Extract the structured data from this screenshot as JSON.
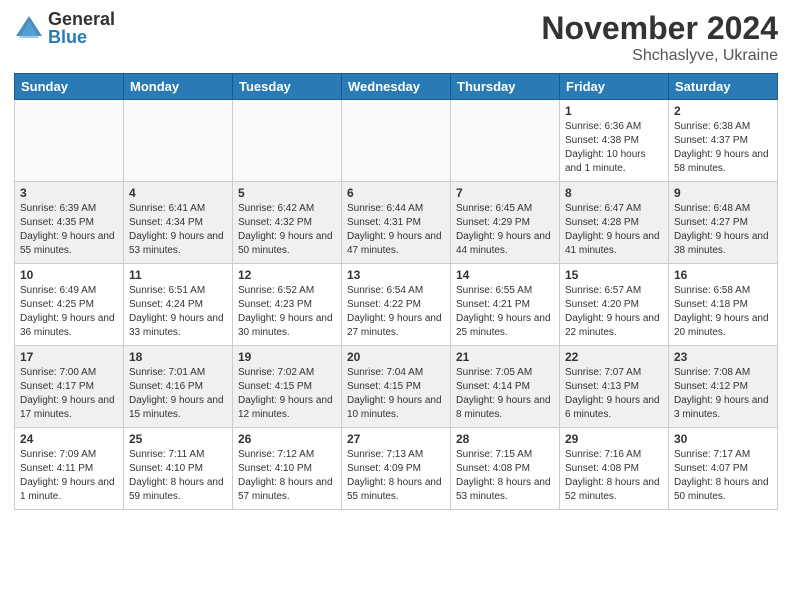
{
  "header": {
    "logo_general": "General",
    "logo_blue": "Blue",
    "month_title": "November 2024",
    "location": "Shchaslyve, Ukraine"
  },
  "weekdays": [
    "Sunday",
    "Monday",
    "Tuesday",
    "Wednesday",
    "Thursday",
    "Friday",
    "Saturday"
  ],
  "weeks": [
    [
      {
        "day": "",
        "empty": true
      },
      {
        "day": "",
        "empty": true
      },
      {
        "day": "",
        "empty": true
      },
      {
        "day": "",
        "empty": true
      },
      {
        "day": "",
        "empty": true
      },
      {
        "day": "1",
        "sunrise": "Sunrise: 6:36 AM",
        "sunset": "Sunset: 4:38 PM",
        "daylight": "Daylight: 10 hours and 1 minute."
      },
      {
        "day": "2",
        "sunrise": "Sunrise: 6:38 AM",
        "sunset": "Sunset: 4:37 PM",
        "daylight": "Daylight: 9 hours and 58 minutes."
      }
    ],
    [
      {
        "day": "3",
        "sunrise": "Sunrise: 6:39 AM",
        "sunset": "Sunset: 4:35 PM",
        "daylight": "Daylight: 9 hours and 55 minutes."
      },
      {
        "day": "4",
        "sunrise": "Sunrise: 6:41 AM",
        "sunset": "Sunset: 4:34 PM",
        "daylight": "Daylight: 9 hours and 53 minutes."
      },
      {
        "day": "5",
        "sunrise": "Sunrise: 6:42 AM",
        "sunset": "Sunset: 4:32 PM",
        "daylight": "Daylight: 9 hours and 50 minutes."
      },
      {
        "day": "6",
        "sunrise": "Sunrise: 6:44 AM",
        "sunset": "Sunset: 4:31 PM",
        "daylight": "Daylight: 9 hours and 47 minutes."
      },
      {
        "day": "7",
        "sunrise": "Sunrise: 6:45 AM",
        "sunset": "Sunset: 4:29 PM",
        "daylight": "Daylight: 9 hours and 44 minutes."
      },
      {
        "day": "8",
        "sunrise": "Sunrise: 6:47 AM",
        "sunset": "Sunset: 4:28 PM",
        "daylight": "Daylight: 9 hours and 41 minutes."
      },
      {
        "day": "9",
        "sunrise": "Sunrise: 6:48 AM",
        "sunset": "Sunset: 4:27 PM",
        "daylight": "Daylight: 9 hours and 38 minutes."
      }
    ],
    [
      {
        "day": "10",
        "sunrise": "Sunrise: 6:49 AM",
        "sunset": "Sunset: 4:25 PM",
        "daylight": "Daylight: 9 hours and 36 minutes."
      },
      {
        "day": "11",
        "sunrise": "Sunrise: 6:51 AM",
        "sunset": "Sunset: 4:24 PM",
        "daylight": "Daylight: 9 hours and 33 minutes."
      },
      {
        "day": "12",
        "sunrise": "Sunrise: 6:52 AM",
        "sunset": "Sunset: 4:23 PM",
        "daylight": "Daylight: 9 hours and 30 minutes."
      },
      {
        "day": "13",
        "sunrise": "Sunrise: 6:54 AM",
        "sunset": "Sunset: 4:22 PM",
        "daylight": "Daylight: 9 hours and 27 minutes."
      },
      {
        "day": "14",
        "sunrise": "Sunrise: 6:55 AM",
        "sunset": "Sunset: 4:21 PM",
        "daylight": "Daylight: 9 hours and 25 minutes."
      },
      {
        "day": "15",
        "sunrise": "Sunrise: 6:57 AM",
        "sunset": "Sunset: 4:20 PM",
        "daylight": "Daylight: 9 hours and 22 minutes."
      },
      {
        "day": "16",
        "sunrise": "Sunrise: 6:58 AM",
        "sunset": "Sunset: 4:18 PM",
        "daylight": "Daylight: 9 hours and 20 minutes."
      }
    ],
    [
      {
        "day": "17",
        "sunrise": "Sunrise: 7:00 AM",
        "sunset": "Sunset: 4:17 PM",
        "daylight": "Daylight: 9 hours and 17 minutes."
      },
      {
        "day": "18",
        "sunrise": "Sunrise: 7:01 AM",
        "sunset": "Sunset: 4:16 PM",
        "daylight": "Daylight: 9 hours and 15 minutes."
      },
      {
        "day": "19",
        "sunrise": "Sunrise: 7:02 AM",
        "sunset": "Sunset: 4:15 PM",
        "daylight": "Daylight: 9 hours and 12 minutes."
      },
      {
        "day": "20",
        "sunrise": "Sunrise: 7:04 AM",
        "sunset": "Sunset: 4:15 PM",
        "daylight": "Daylight: 9 hours and 10 minutes."
      },
      {
        "day": "21",
        "sunrise": "Sunrise: 7:05 AM",
        "sunset": "Sunset: 4:14 PM",
        "daylight": "Daylight: 9 hours and 8 minutes."
      },
      {
        "day": "22",
        "sunrise": "Sunrise: 7:07 AM",
        "sunset": "Sunset: 4:13 PM",
        "daylight": "Daylight: 9 hours and 6 minutes."
      },
      {
        "day": "23",
        "sunrise": "Sunrise: 7:08 AM",
        "sunset": "Sunset: 4:12 PM",
        "daylight": "Daylight: 9 hours and 3 minutes."
      }
    ],
    [
      {
        "day": "24",
        "sunrise": "Sunrise: 7:09 AM",
        "sunset": "Sunset: 4:11 PM",
        "daylight": "Daylight: 9 hours and 1 minute."
      },
      {
        "day": "25",
        "sunrise": "Sunrise: 7:11 AM",
        "sunset": "Sunset: 4:10 PM",
        "daylight": "Daylight: 8 hours and 59 minutes."
      },
      {
        "day": "26",
        "sunrise": "Sunrise: 7:12 AM",
        "sunset": "Sunset: 4:10 PM",
        "daylight": "Daylight: 8 hours and 57 minutes."
      },
      {
        "day": "27",
        "sunrise": "Sunrise: 7:13 AM",
        "sunset": "Sunset: 4:09 PM",
        "daylight": "Daylight: 8 hours and 55 minutes."
      },
      {
        "day": "28",
        "sunrise": "Sunrise: 7:15 AM",
        "sunset": "Sunset: 4:08 PM",
        "daylight": "Daylight: 8 hours and 53 minutes."
      },
      {
        "day": "29",
        "sunrise": "Sunrise: 7:16 AM",
        "sunset": "Sunset: 4:08 PM",
        "daylight": "Daylight: 8 hours and 52 minutes."
      },
      {
        "day": "30",
        "sunrise": "Sunrise: 7:17 AM",
        "sunset": "Sunset: 4:07 PM",
        "daylight": "Daylight: 8 hours and 50 minutes."
      }
    ]
  ]
}
